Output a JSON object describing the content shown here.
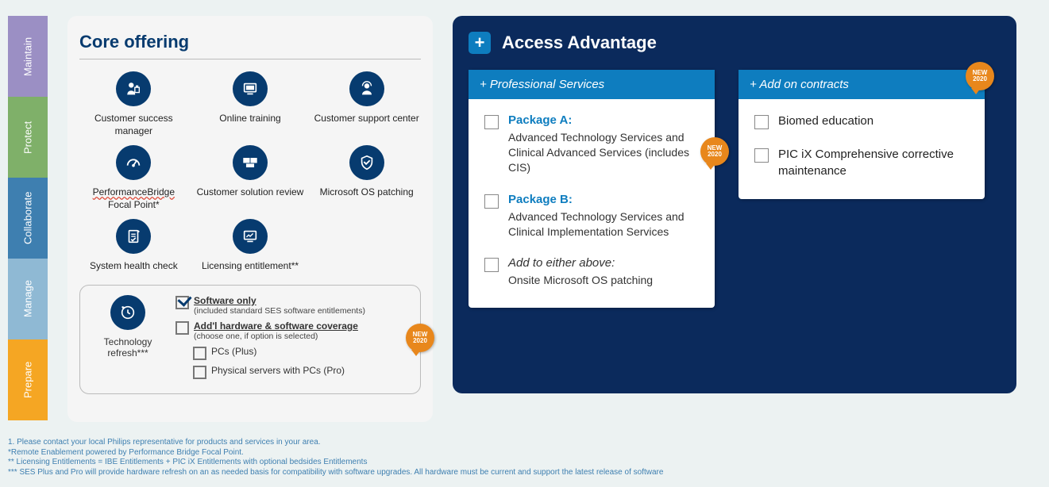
{
  "sidebar": {
    "tabs": [
      "Maintain",
      "Protect",
      "Collaborate",
      "Manage",
      "Prepare"
    ]
  },
  "core": {
    "title": "Core offering",
    "icons": [
      {
        "label": "Customer success manager"
      },
      {
        "label": "Online training"
      },
      {
        "label": "Customer support center"
      },
      {
        "label": "PerformanceBridge Focal Point*",
        "wavy": true,
        "wavy_text": "PerformanceBridge",
        "rest": "Focal Point*"
      },
      {
        "label": "Customer solution review"
      },
      {
        "label": "Microsoft OS patching"
      },
      {
        "label": "System health check"
      },
      {
        "label": "Licensing entitlement**"
      }
    ],
    "tech_refresh_label": "Technology refresh***",
    "options": {
      "software_only": {
        "label": "Software only",
        "sub": "(included standard SES software entitlements)",
        "checked": true
      },
      "addl_hw": {
        "label": "Add'l hardware & software coverage",
        "sub": "(choose one, if option is selected)",
        "checked": false
      },
      "pcs_plus": {
        "label": "PCs (Plus)",
        "checked": false
      },
      "servers_pro": {
        "label": "Physical servers with PCs (Pro)",
        "checked": false
      }
    },
    "badge": {
      "line1": "NEW",
      "line2": "2020"
    }
  },
  "access": {
    "title": "Access Advantage",
    "prof_header": "+ Professional Services",
    "addon_header": "+ Add on contracts",
    "packages": [
      {
        "title": "Package A:",
        "desc": "Advanced Technology Services and Clinical Advanced Services (includes CIS)",
        "has_badge": true
      },
      {
        "title": "Package B:",
        "desc": "Advanced Technology Services and Clinical Implementation Services"
      }
    ],
    "either": {
      "lead": "Add to either above:",
      "desc": "Onsite Microsoft OS patching"
    },
    "addons": [
      {
        "desc": "Biomed education"
      },
      {
        "desc": "PIC iX Comprehensive corrective maintenance"
      }
    ],
    "badge": {
      "line1": "NEW",
      "line2": "2020"
    }
  },
  "footnotes": [
    "1. Please contact your local Philips representative for products and services in your area.",
    "*Remote Enablement powered by Performance Bridge Focal Point.",
    "** Licensing Entitlements = IBE Entitlements + PIC iX Entitlements with optional bedsides Entitlements",
    "*** SES Plus and Pro will provide hardware refresh on an as needed basis for compatibility with software upgrades. All hardware must be current and support the latest release of software"
  ]
}
